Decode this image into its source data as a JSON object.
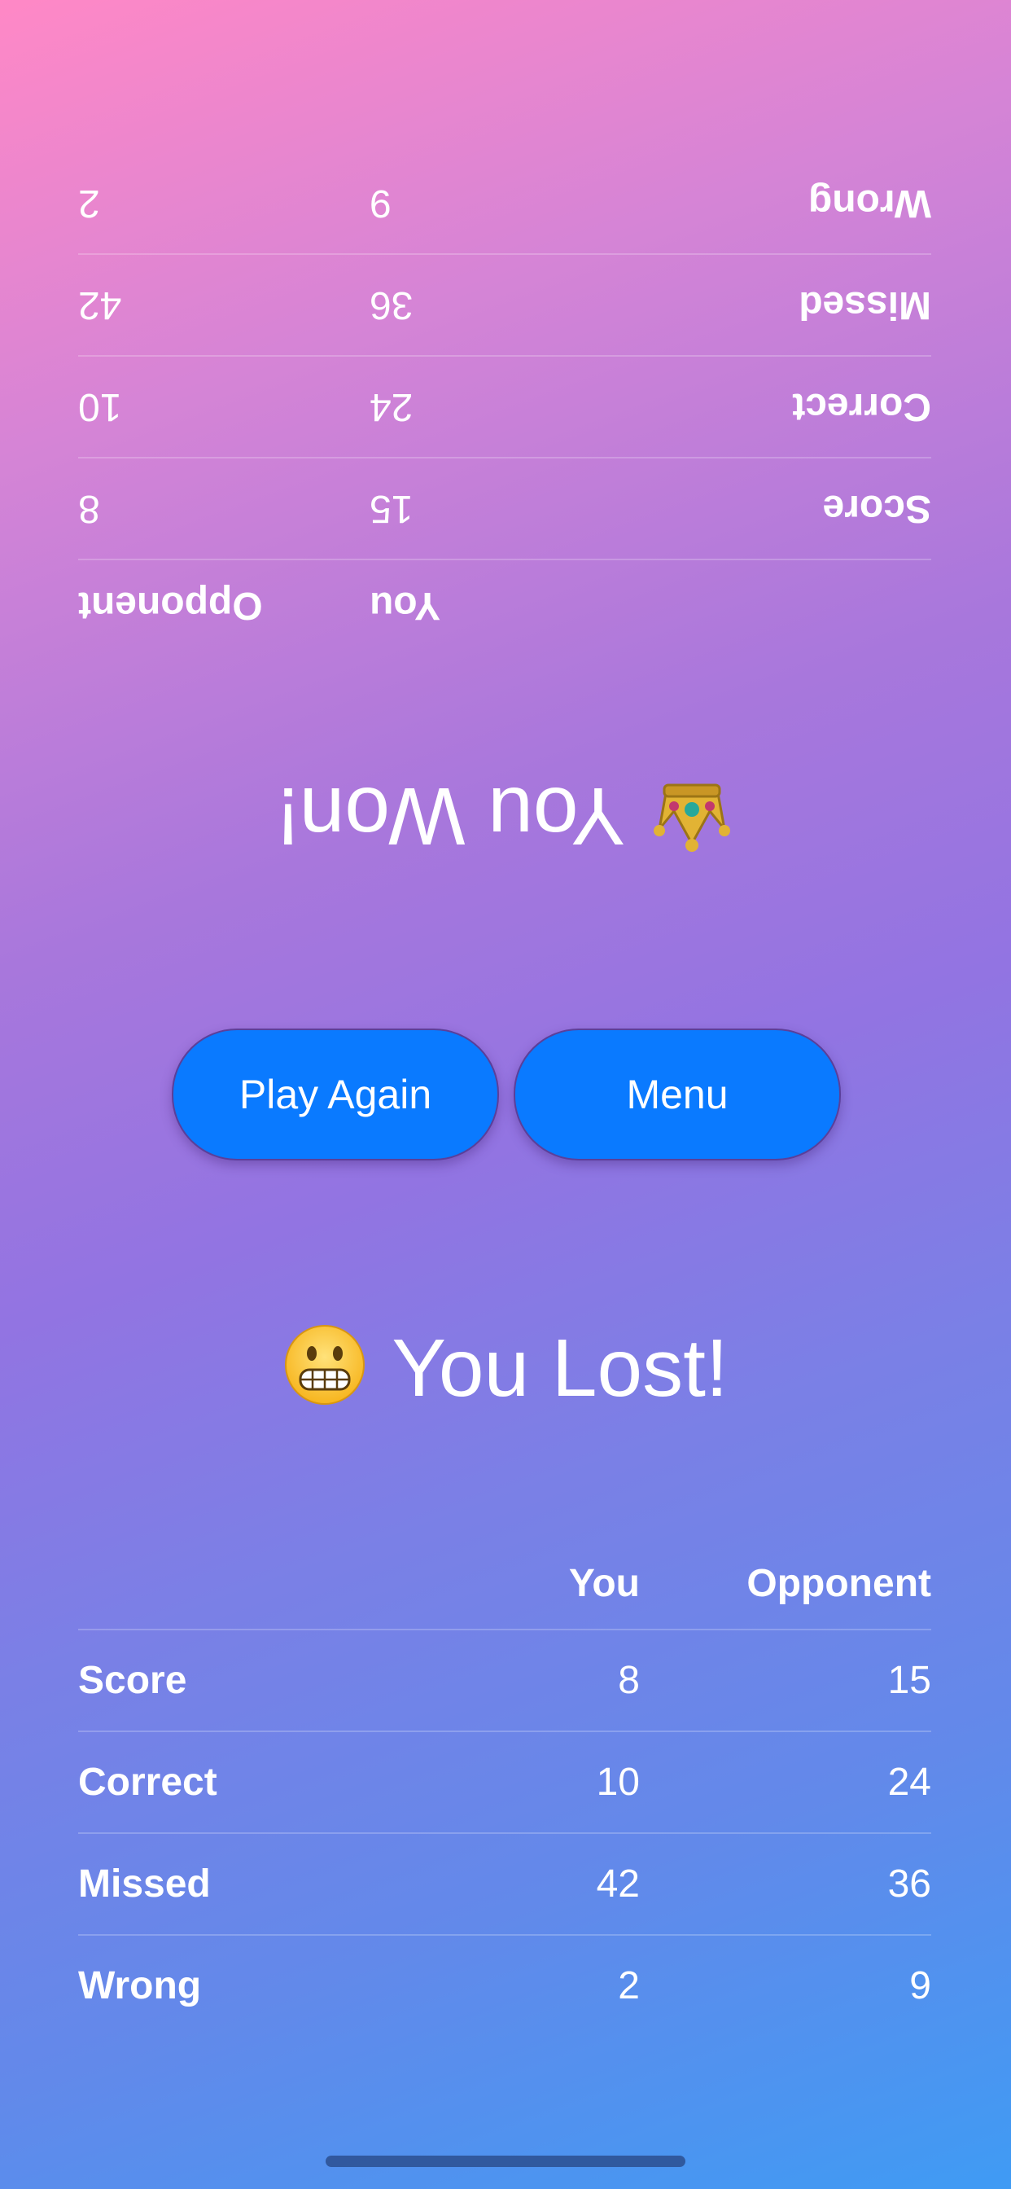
{
  "stat_columns": {
    "you": "You",
    "opponent": "Opponent"
  },
  "opponent_view": {
    "result_text": "You Won!",
    "result_icon": "crown-icon",
    "rows": [
      {
        "label": "Score",
        "you": "15",
        "opponent": "8"
      },
      {
        "label": "Correct",
        "you": "24",
        "opponent": "10"
      },
      {
        "label": "Missed",
        "you": "36",
        "opponent": "42"
      },
      {
        "label": "Wrong",
        "you": "9",
        "opponent": "2"
      }
    ]
  },
  "player_view": {
    "result_text": "You Lost!",
    "result_icon": "grimacing-face-icon",
    "rows": [
      {
        "label": "Score",
        "you": "8",
        "opponent": "15"
      },
      {
        "label": "Correct",
        "you": "10",
        "opponent": "24"
      },
      {
        "label": "Missed",
        "you": "42",
        "opponent": "36"
      },
      {
        "label": "Wrong",
        "you": "2",
        "opponent": "9"
      }
    ]
  },
  "buttons": {
    "play_again": "Play Again",
    "menu": "Menu"
  },
  "colors": {
    "button": "#0a7aff",
    "gradient_top": "#ff88c6",
    "gradient_bottom": "#3f9bf4"
  }
}
